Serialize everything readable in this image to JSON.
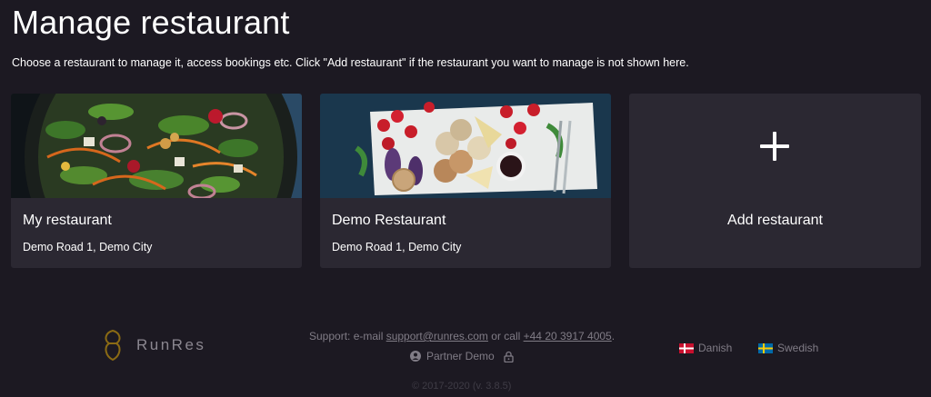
{
  "header": {
    "title": "Manage restaurant",
    "subtitle": "Choose a restaurant to manage it, access bookings etc. Click \"Add restaurant\" if the restaurant you want to manage is not shown here."
  },
  "restaurants": [
    {
      "name": "My restaurant",
      "address": "Demo Road 1, Demo City",
      "image": "salad-photo"
    },
    {
      "name": "Demo Restaurant",
      "address": "Demo Road 1, Demo City",
      "image": "cheese-platter-photo"
    }
  ],
  "add_card": {
    "label": "Add restaurant",
    "icon": "plus-icon"
  },
  "footer": {
    "brand": "RunRes",
    "support_prefix": "Support: e-mail ",
    "support_email": "support@runres.com",
    "support_middle": " or call ",
    "support_phone": "+44 20 3917 4005",
    "support_suffix": ".",
    "partner": "Partner Demo",
    "copyright": "© 2017-2020 (v. 3.8.5)",
    "languages": [
      {
        "label": "Danish",
        "flag": "danish-flag"
      },
      {
        "label": "Swedish",
        "flag": "swedish-flag"
      }
    ]
  },
  "colors": {
    "background": "#1c1922",
    "card": "#2b2832",
    "footer_text": "#807c86"
  }
}
